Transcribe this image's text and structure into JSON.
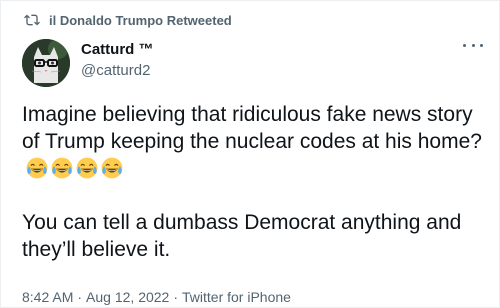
{
  "retweet": {
    "label": "il Donaldo Trumpo Retweeted"
  },
  "author": {
    "display_name": "Catturd ™",
    "handle": "@catturd2"
  },
  "tweet": {
    "paragraph1": "Imagine believing that ridiculous fake news story of Trump keeping the nuclear codes at his home?",
    "paragraph2": "You can tell a dumbass Democrat anything and they’ll believe it.",
    "emoji": [
      "face-with-tears-of-joy",
      "face-with-tears-of-joy",
      "face-with-tears-of-joy",
      "face-with-tears-of-joy"
    ]
  },
  "meta": {
    "time": "8:42 AM",
    "separator": "·",
    "date": "Aug 12, 2022",
    "source": "Twitter for iPhone"
  },
  "colors": {
    "text_primary": "#0f1419",
    "text_secondary": "#536471",
    "emoji_yellow": "#ffcc4d"
  }
}
